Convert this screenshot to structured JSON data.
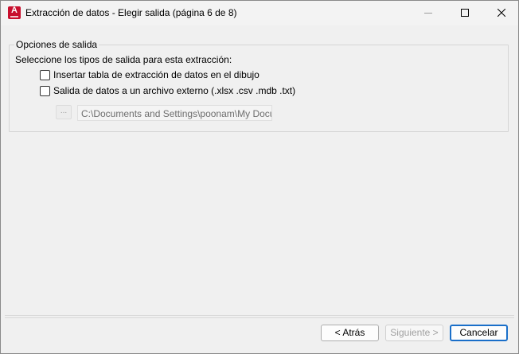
{
  "window": {
    "title": "Extracción de datos - Elegir salida (página 6 de 8)",
    "app_icon_glyph": "A",
    "buttons": {
      "minimize": "minimize-icon",
      "maximize": "maximize-icon",
      "close": "close-icon"
    }
  },
  "output_options": {
    "legend": "Opciones de salida",
    "instructions": "Seleccione los tipos de salida para esta extracción:",
    "insert_table": {
      "label": "Insertar tabla de extracción de datos en el dibujo",
      "checked": false
    },
    "external_file": {
      "label": "Salida de datos a un archivo externo (.xlsx .csv .mdb .txt)",
      "checked": false
    },
    "browse_button_label": "...",
    "file_path": "C:\\Documents and Settings\\poonam\\My Documer"
  },
  "footer": {
    "back_label": "< Atrás",
    "next_label": "Siguiente >",
    "cancel_label": "Cancelar"
  },
  "colors": {
    "accent": "#1a6fc9",
    "app_icon": "#c8102e"
  }
}
